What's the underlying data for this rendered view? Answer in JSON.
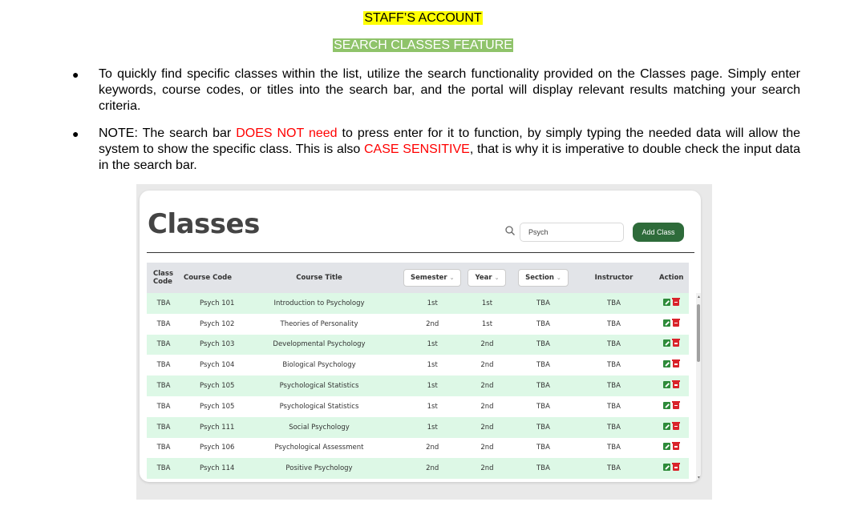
{
  "doc": {
    "heading1": "STAFF’S ACCOUNT",
    "heading2": "SEARCH CLASSES FEATURE",
    "bullet1": "To quickly find specific classes within the list, utilize the search functionality provided on the Classes page. Simply enter keywords, course codes, or titles into the search bar, and the portal will display relevant results matching your search criteria.",
    "bullet2_part1": "NOTE: The search bar ",
    "bullet2_red1": "DOES NOT need",
    "bullet2_part2": " to press enter for it to function, by simply typing the needed data will allow the system to show the specific class. This is also ",
    "bullet2_red2": "CASE SENSITIVE",
    "bullet2_part3": ", that is why it is imperative to double check the input data in the search bar."
  },
  "app": {
    "page_title": "Classes",
    "search_value": "Psych",
    "add_button": "Add Class",
    "accent_color": "#2e6b3a",
    "row_highlight": "#ddf8e6"
  },
  "table": {
    "headers": {
      "class_code": "Class Code",
      "course_code": "Course Code",
      "course_title": "Course Title",
      "semester": "Semester",
      "year": "Year",
      "section": "Section",
      "instructor": "Instructor",
      "action": "Action"
    },
    "rows": [
      {
        "class_code": "TBA",
        "course_code": "Psych 101",
        "course_title": "Introduction to Psychology",
        "semester": "1st",
        "year": "1st",
        "section": "TBA",
        "instructor": "TBA"
      },
      {
        "class_code": "TBA",
        "course_code": "Psych 102",
        "course_title": "Theories of Personality",
        "semester": "2nd",
        "year": "1st",
        "section": "TBA",
        "instructor": "TBA"
      },
      {
        "class_code": "TBA",
        "course_code": "Psych 103",
        "course_title": "Developmental Psychology",
        "semester": "1st",
        "year": "2nd",
        "section": "TBA",
        "instructor": "TBA"
      },
      {
        "class_code": "TBA",
        "course_code": "Psych 104",
        "course_title": "Biological Psychology",
        "semester": "1st",
        "year": "2nd",
        "section": "TBA",
        "instructor": "TBA"
      },
      {
        "class_code": "TBA",
        "course_code": "Psych 105",
        "course_title": "Psychological Statistics",
        "semester": "1st",
        "year": "2nd",
        "section": "TBA",
        "instructor": "TBA"
      },
      {
        "class_code": "TBA",
        "course_code": "Psych 105",
        "course_title": "Psychological Statistics",
        "semester": "1st",
        "year": "2nd",
        "section": "TBA",
        "instructor": "TBA"
      },
      {
        "class_code": "TBA",
        "course_code": "Psych 111",
        "course_title": "Social Psychology",
        "semester": "1st",
        "year": "2nd",
        "section": "TBA",
        "instructor": "TBA"
      },
      {
        "class_code": "TBA",
        "course_code": "Psych 106",
        "course_title": "Psychological Assessment",
        "semester": "2nd",
        "year": "2nd",
        "section": "TBA",
        "instructor": "TBA"
      },
      {
        "class_code": "TBA",
        "course_code": "Psych 114",
        "course_title": "Positive Psychology",
        "semester": "2nd",
        "year": "2nd",
        "section": "TBA",
        "instructor": "TBA"
      }
    ]
  }
}
